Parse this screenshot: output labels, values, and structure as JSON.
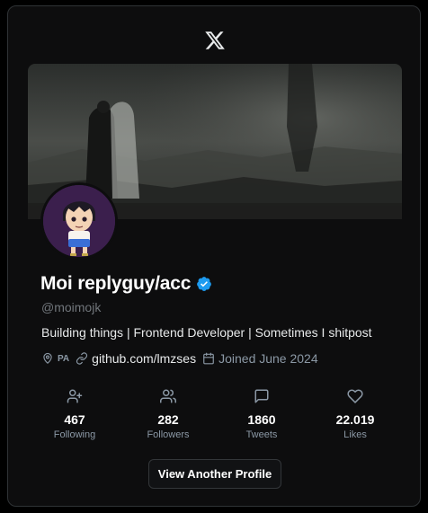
{
  "header": {
    "logo_icon": "x-logo-icon"
  },
  "profile": {
    "name": "Moi replyguy/acc",
    "verified": true,
    "verified_color": "#1d9bf0",
    "handle": "@moimojk",
    "bio": "Building things | Frontend Developer | Sometimes I shitpost",
    "location": "PA",
    "website": "github.com/lmzses",
    "joined": "Joined June 2024"
  },
  "stats": [
    {
      "icon": "user-plus-icon",
      "value": "467",
      "label": "Following"
    },
    {
      "icon": "users-icon",
      "value": "282",
      "label": "Followers"
    },
    {
      "icon": "message-icon",
      "value": "1860",
      "label": "Tweets"
    },
    {
      "icon": "heart-icon",
      "value": "22.019",
      "label": "Likes"
    }
  ],
  "actions": {
    "view_another_label": "View Another Profile"
  }
}
